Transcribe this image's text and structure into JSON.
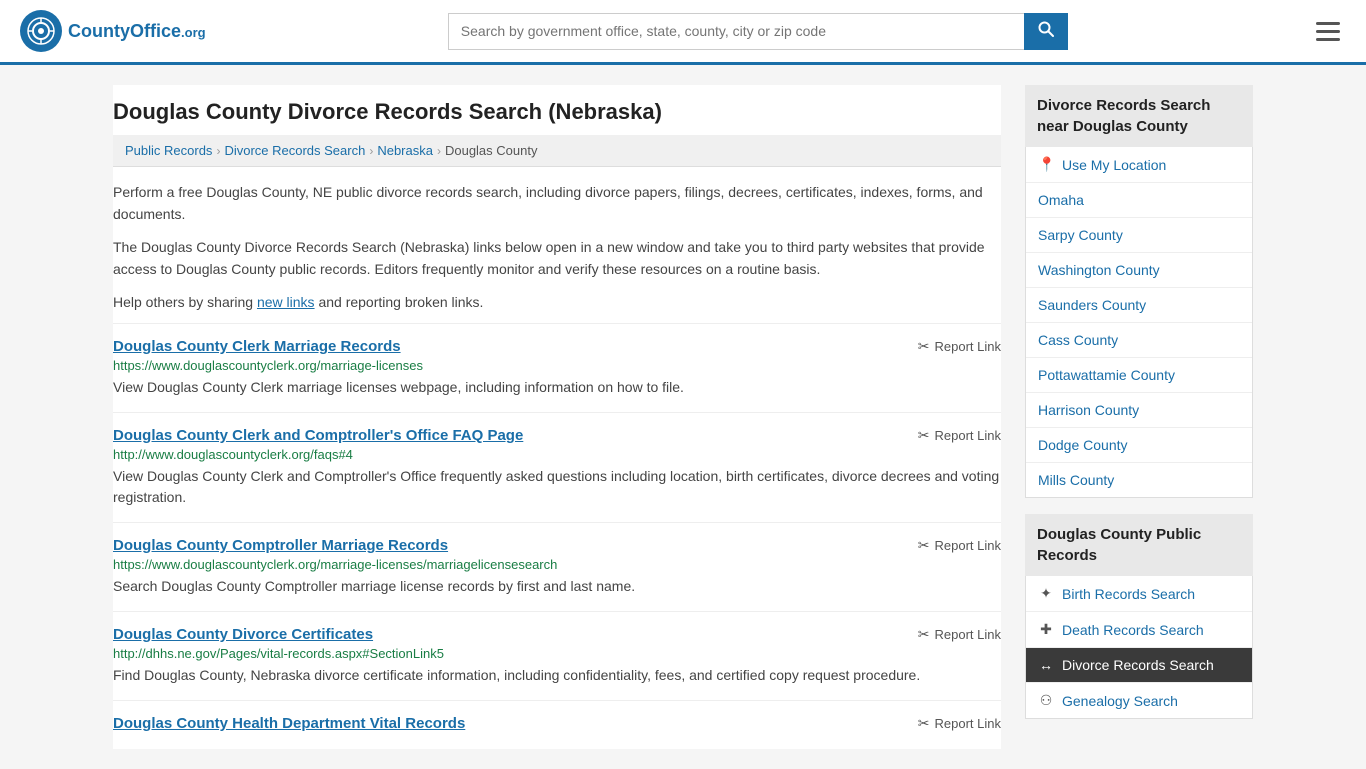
{
  "header": {
    "logo_text": "CountyOffice",
    "logo_org": ".org",
    "search_placeholder": "Search by government office, state, county, city or zip code"
  },
  "page": {
    "title": "Douglas County Divorce Records Search (Nebraska)",
    "breadcrumbs": [
      {
        "label": "Public Records",
        "href": "#"
      },
      {
        "label": "Divorce Records Search",
        "href": "#"
      },
      {
        "label": "Nebraska",
        "href": "#"
      },
      {
        "label": "Douglas County",
        "href": "#"
      }
    ],
    "intro1": "Perform a free Douglas County, NE public divorce records search, including divorce papers, filings, decrees, certificates, indexes, forms, and documents.",
    "intro2": "The Douglas County Divorce Records Search (Nebraska) links below open in a new window and take you to third party websites that provide access to Douglas County public records. Editors frequently monitor and verify these resources on a routine basis.",
    "intro3_pre": "Help others by sharing ",
    "intro3_link": "new links",
    "intro3_post": " and reporting broken links."
  },
  "results": [
    {
      "title": "Douglas County Clerk Marriage Records",
      "url": "https://www.douglascountyclerk.org/marriage-licenses",
      "desc": "View Douglas County Clerk marriage licenses webpage, including information on how to file.",
      "report": "Report Link"
    },
    {
      "title": "Douglas County Clerk and Comptroller's Office FAQ Page",
      "url": "http://www.douglascountyclerk.org/faqs#4",
      "desc": "View Douglas County Clerk and Comptroller's Office frequently asked questions including location, birth certificates, divorce decrees and voting registration.",
      "report": "Report Link"
    },
    {
      "title": "Douglas County Comptroller Marriage Records",
      "url": "https://www.douglascountyclerk.org/marriage-licenses/marriagelicensesearch",
      "desc": "Search Douglas County Comptroller marriage license records by first and last name.",
      "report": "Report Link"
    },
    {
      "title": "Douglas County Divorce Certificates",
      "url": "http://dhhs.ne.gov/Pages/vital-records.aspx#SectionLink5",
      "desc": "Find Douglas County, Nebraska divorce certificate information, including confidentiality, fees, and certified copy request procedure.",
      "report": "Report Link"
    },
    {
      "title": "Douglas County Health Department Vital Records",
      "url": "",
      "desc": "",
      "report": "Report Link"
    }
  ],
  "sidebar": {
    "nearby_header": "Divorce Records Search near Douglas County",
    "use_location": "Use My Location",
    "nearby_items": [
      {
        "label": "Omaha",
        "href": "#"
      },
      {
        "label": "Sarpy County",
        "href": "#"
      },
      {
        "label": "Washington County",
        "href": "#"
      },
      {
        "label": "Saunders County",
        "href": "#"
      },
      {
        "label": "Cass County",
        "href": "#"
      },
      {
        "label": "Pottawattamie County",
        "href": "#"
      },
      {
        "label": "Harrison County",
        "href": "#"
      },
      {
        "label": "Dodge County",
        "href": "#"
      },
      {
        "label": "Mills County",
        "href": "#"
      }
    ],
    "public_records_header": "Douglas County Public Records",
    "public_records_items": [
      {
        "label": "Birth Records Search",
        "icon": "birth",
        "active": false
      },
      {
        "label": "Death Records Search",
        "icon": "death",
        "active": false
      },
      {
        "label": "Divorce Records Search",
        "icon": "divorce",
        "active": true
      },
      {
        "label": "Genealogy Search",
        "icon": "genealogy",
        "active": false
      }
    ]
  }
}
